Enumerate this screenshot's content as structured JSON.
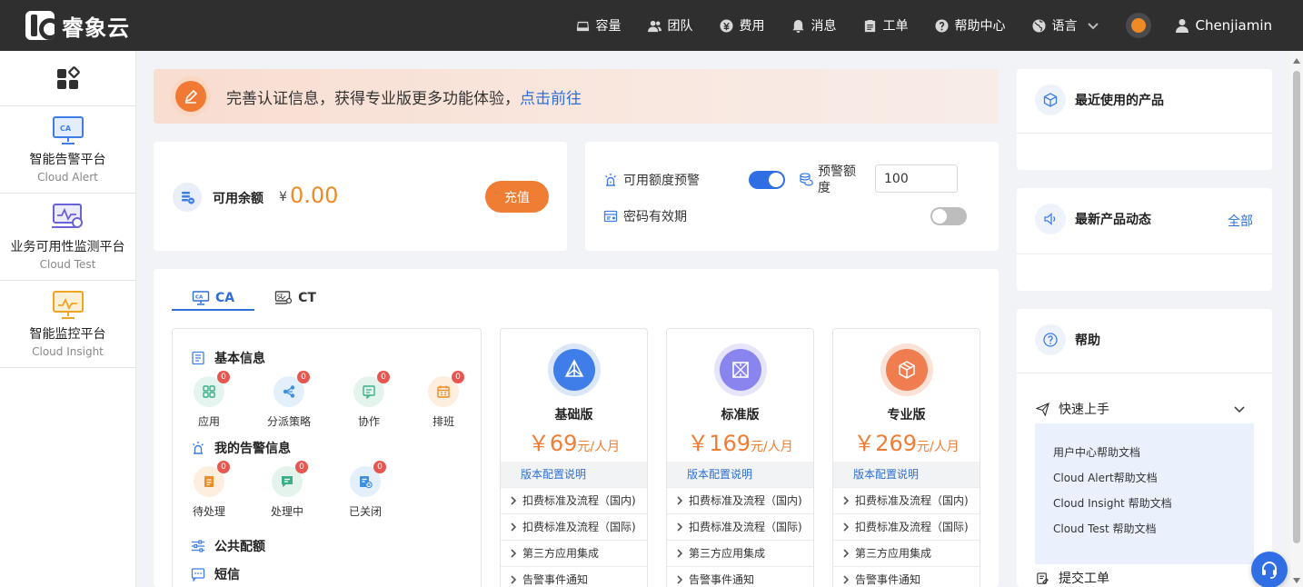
{
  "header": {
    "logo_text": "睿象云",
    "nav": [
      {
        "label": "容量",
        "icon": "storage-icon"
      },
      {
        "label": "团队",
        "icon": "team-icon"
      },
      {
        "label": "费用",
        "icon": "cost-icon"
      },
      {
        "label": "消息",
        "icon": "bell-icon"
      },
      {
        "label": "工单",
        "icon": "ticket-icon"
      },
      {
        "label": "帮助中心",
        "icon": "help-icon"
      },
      {
        "label": "语言",
        "icon": "globe-icon"
      }
    ],
    "user": "Chenjiamin"
  },
  "sidebar": {
    "items": [
      {
        "title": "智能告警平台",
        "subtitle": "Cloud Alert"
      },
      {
        "title": "业务可用性监测平台",
        "subtitle": "Cloud Test"
      },
      {
        "title": "智能监控平台",
        "subtitle": "Cloud Insight"
      }
    ]
  },
  "banner": {
    "text": "完善认证信息，获得专业版更多功能体验，",
    "link": "点击前往"
  },
  "balance": {
    "label": "可用余额",
    "currency": "¥",
    "amount": "0.00",
    "recharge": "充值"
  },
  "alert_settings": {
    "quota_alert_label": "可用额度预警",
    "quota_alert_on": true,
    "threshold_label": "预警额度",
    "threshold_value": "100",
    "password_expiry_label": "密码有效期",
    "password_expiry_on": false
  },
  "tabs": [
    {
      "label": "CA",
      "active": true
    },
    {
      "label": "CT",
      "active": false
    }
  ],
  "basic_info": {
    "title": "基本信息",
    "items": [
      {
        "label": "应用",
        "badge": "0"
      },
      {
        "label": "分派策略",
        "badge": "0"
      },
      {
        "label": "协作",
        "badge": "0"
      },
      {
        "label": "排班",
        "badge": "0"
      }
    ]
  },
  "my_alerts": {
    "title": "我的告警信息",
    "items": [
      {
        "label": "待处理",
        "badge": "0"
      },
      {
        "label": "处理中",
        "badge": "0"
      },
      {
        "label": "已关闭",
        "badge": "0"
      }
    ]
  },
  "public_quota": {
    "title": "公共配额"
  },
  "sms": {
    "title": "短信"
  },
  "plans": [
    {
      "name": "基础版",
      "price": "69",
      "currency": "￥",
      "unit": "元/人月",
      "config": "版本配置说明",
      "rows": [
        "扣费标准及流程（国内)",
        "扣费标准及流程（国际)",
        "第三方应用集成",
        "告警事件通知"
      ],
      "color": "#3f7ee8",
      "ring": "#dbe6f8"
    },
    {
      "name": "标准版",
      "price": "169",
      "currency": "￥",
      "unit": "元/人月",
      "config": "版本配置说明",
      "rows": [
        "扣费标准及流程（国内)",
        "扣费标准及流程（国际)",
        "第三方应用集成",
        "告警事件通知"
      ],
      "color": "#8a84ee",
      "ring": "#e6e4f8"
    },
    {
      "name": "专业版",
      "price": "269",
      "currency": "￥",
      "unit": "元/人月",
      "config": "版本配置说明",
      "rows": [
        "扣费标准及流程（国内)",
        "扣费标准及流程（国际)",
        "第三方应用集成",
        "告警事件通知"
      ],
      "color": "#f07d4f",
      "ring": "#fbe1d6"
    }
  ],
  "right": {
    "recent": {
      "title": "最近使用的产品"
    },
    "news": {
      "title": "最新产品动态",
      "link": "全部"
    },
    "help": {
      "title": "帮助",
      "quick_start": "快速上手",
      "docs": [
        "用户中心帮助文档",
        "Cloud Alert帮助文档",
        "Cloud Insight 帮助文档",
        "Cloud Test 帮助文档"
      ],
      "submit_ticket": "提交工单"
    }
  },
  "colors": {
    "accent": "#2d6fd6",
    "orange": "#f07d34",
    "header": "#2f2f30"
  }
}
